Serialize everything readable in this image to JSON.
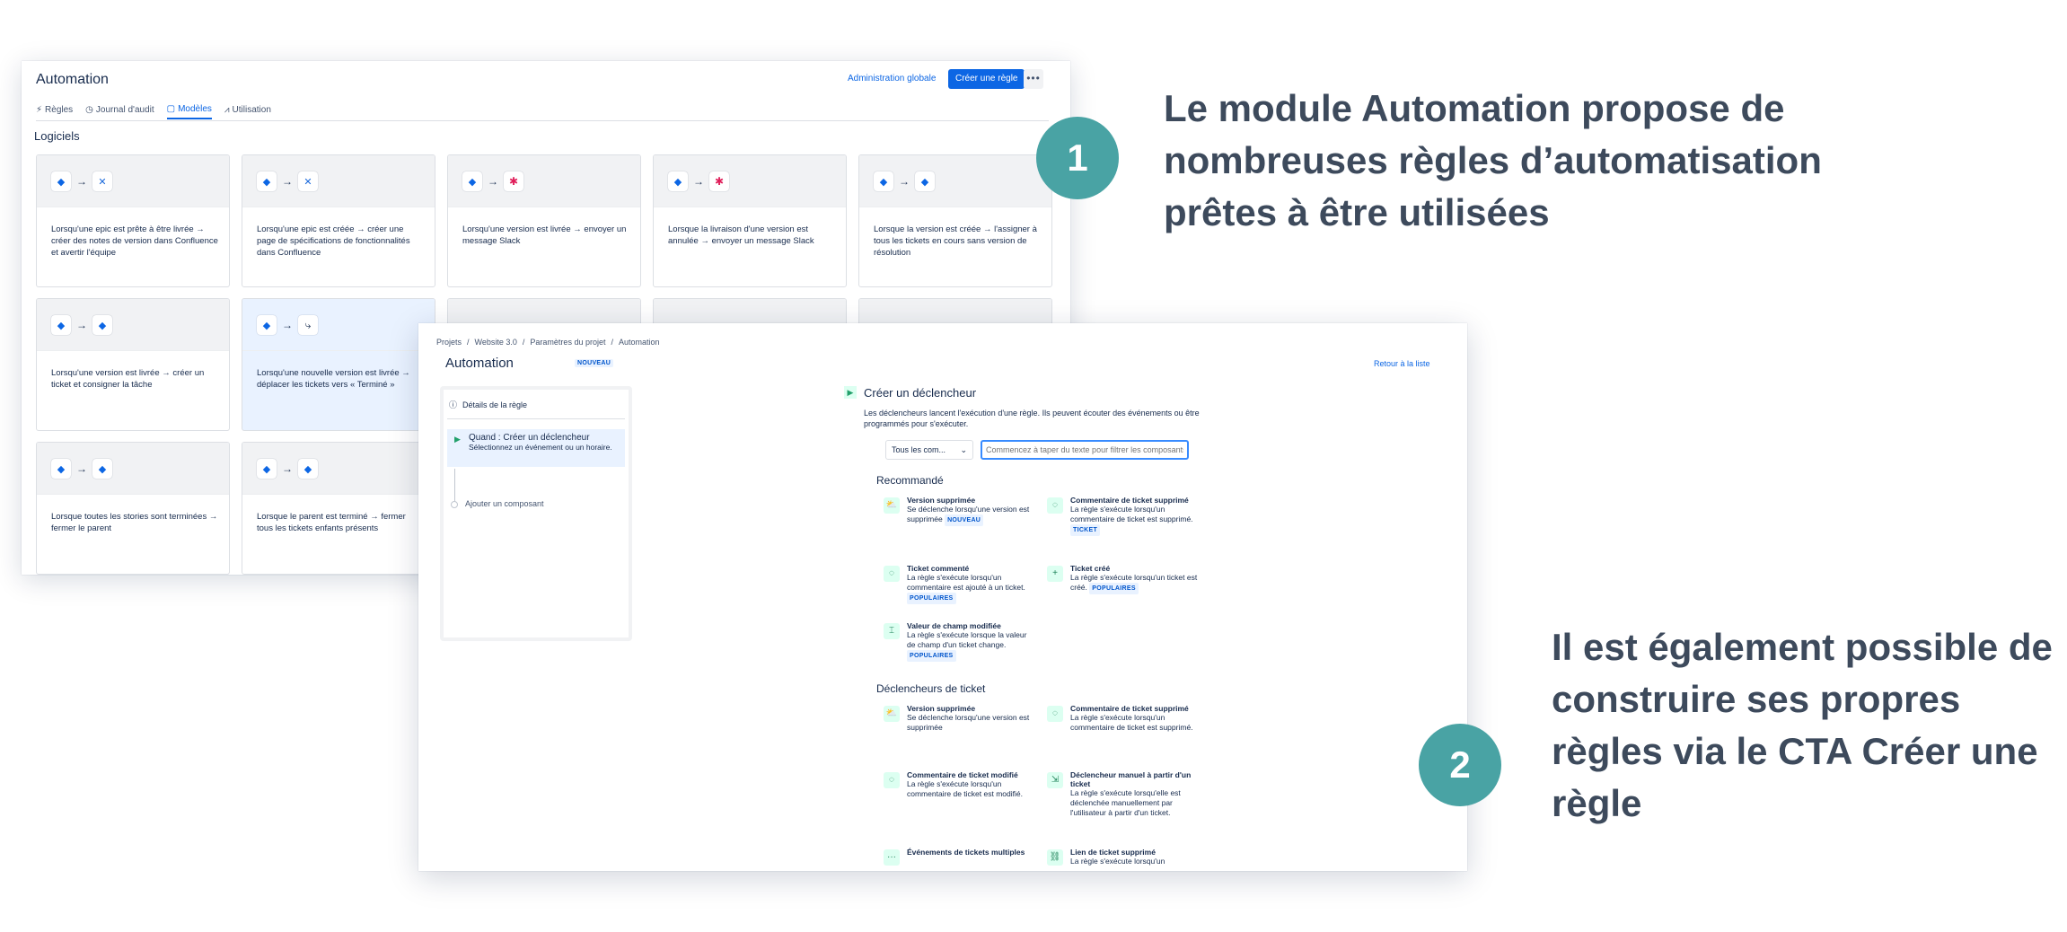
{
  "shot1": {
    "title": "Automation",
    "admin_link": "Administration globale",
    "create_button": "Créer une règle",
    "more_glyph": "•••",
    "tabs": [
      {
        "label": "Règles",
        "icon": "bolt-icon",
        "glyph": "⚡"
      },
      {
        "label": "Journal d'audit",
        "icon": "clock-icon",
        "glyph": "◷"
      },
      {
        "label": "Modèles",
        "icon": "template-icon",
        "glyph": "▢"
      },
      {
        "label": "Utilisation",
        "icon": "chart-icon",
        "glyph": "⩘"
      }
    ],
    "active_tab": "Modèles",
    "section": "Logiciels",
    "arrow_glyph": "→",
    "cards": [
      {
        "text": "Lorsqu'une epic est prête à être livrée → créer des notes de version dans Confluence et avertir l'équipe"
      },
      {
        "text": "Lorsqu'une epic est créée → créer une page de spécifications de fonctionnalités dans Confluence"
      },
      {
        "text": "Lorsqu'une version est livrée → envoyer un message Slack"
      },
      {
        "text": "Lorsque la livraison d'une version est annulée → envoyer un message Slack"
      },
      {
        "text": "Lorsque la version est créée → l'assigner à tous les tickets en cours sans version de résolution"
      },
      {
        "text": "Lorsqu'une version est livrée → créer un ticket et consigner la tâche"
      },
      {
        "text": "Lorsqu'une nouvelle version est livrée → déplacer les tickets vers « Terminé »"
      },
      {
        "text": "Lorsque toutes les stories sont terminées → fermer le parent"
      },
      {
        "text": "Lorsque le parent est terminé → fermer tous les tickets enfants présents"
      }
    ]
  },
  "shot2": {
    "breadcrumb": [
      "Projets",
      "/",
      "Website 3.0",
      "/",
      "Paramètres du projet",
      "/",
      "Automation"
    ],
    "title": "Automation",
    "new_badge": "NOUVEAU",
    "back_link": "Retour à la liste",
    "panel": {
      "details": "Détails de la règle",
      "when_title": "Quand : Créer un déclencheur",
      "when_sub": "Sélectionnez un événement ou un horaire.",
      "add": "Ajouter un composant"
    },
    "trigger_title": "Créer un déclencheur",
    "trigger_desc": "Les déclencheurs lancent l'exécution d'une règle. Ils peuvent écouter des événements ou être programmés pour s'exécuter.",
    "filter_value": "Tous les com...",
    "search_placeholder": "Commencez à taper du texte pour filtrer les composants",
    "recommended_heading": "Recommandé",
    "recommended": [
      {
        "title": "Version supprimée",
        "desc": "Se déclenche lorsqu'une version est supprimée",
        "badge": "NOUVEAU",
        "glyph": "⛅"
      },
      {
        "title": "Commentaire de ticket supprimé",
        "desc": "La règle s'exécute lorsqu'un commentaire de ticket est supprimé.",
        "badge": "TICKET",
        "glyph": "◌"
      },
      {
        "title": "Ticket commenté",
        "desc": "La règle s'exécute lorsqu'un commentaire est ajouté à un ticket.",
        "badge": "POPULAIRES",
        "glyph": "◌"
      },
      {
        "title": "Ticket créé",
        "desc": "La règle s'exécute lorsqu'un ticket est créé.",
        "badge": "POPULAIRES",
        "glyph": "+"
      },
      {
        "title": "Valeur de champ modifiée",
        "desc": "La règle s'exécute lorsque la valeur de champ d'un ticket change.",
        "badge": "POPULAIRES",
        "glyph": "⌶"
      }
    ],
    "ticket_heading": "Déclencheurs de ticket",
    "ticket_triggers": [
      {
        "title": "Version supprimée",
        "desc": "Se déclenche lorsqu'une version est supprimée",
        "glyph": "⛅"
      },
      {
        "title": "Commentaire de ticket supprimé",
        "desc": "La règle s'exécute lorsqu'un commentaire de ticket est supprimé.",
        "glyph": "◌"
      },
      {
        "title": "Commentaire de ticket modifié",
        "desc": "La règle s'exécute lorsqu'un commentaire de ticket est modifié.",
        "glyph": "◌"
      },
      {
        "title": "Déclencheur manuel à partir d'un ticket",
        "desc": "La règle s'exécute lorsqu'elle est déclenchée manuellement par l'utilisateur à partir d'un ticket.",
        "glyph": "⇲"
      },
      {
        "title": "Événements de tickets multiples",
        "desc": "",
        "glyph": "···"
      },
      {
        "title": "Lien de ticket supprimé",
        "desc": "La règle s'exécute lorsqu'un",
        "glyph": "⛓"
      }
    ]
  },
  "captions": {
    "one_number": "1",
    "one_text": "Le module Automation propose de nombreuses règles d’automatisation prêtes à être utilisées",
    "two_number": "2",
    "two_text": "Il est également possible de construire ses propres règles via le CTA Créer une règle"
  },
  "colors": {
    "accent": "#0c66e4",
    "badge": "#49a3a4",
    "caption": "#3d4a5c",
    "trigger_green": "#22a06b"
  }
}
